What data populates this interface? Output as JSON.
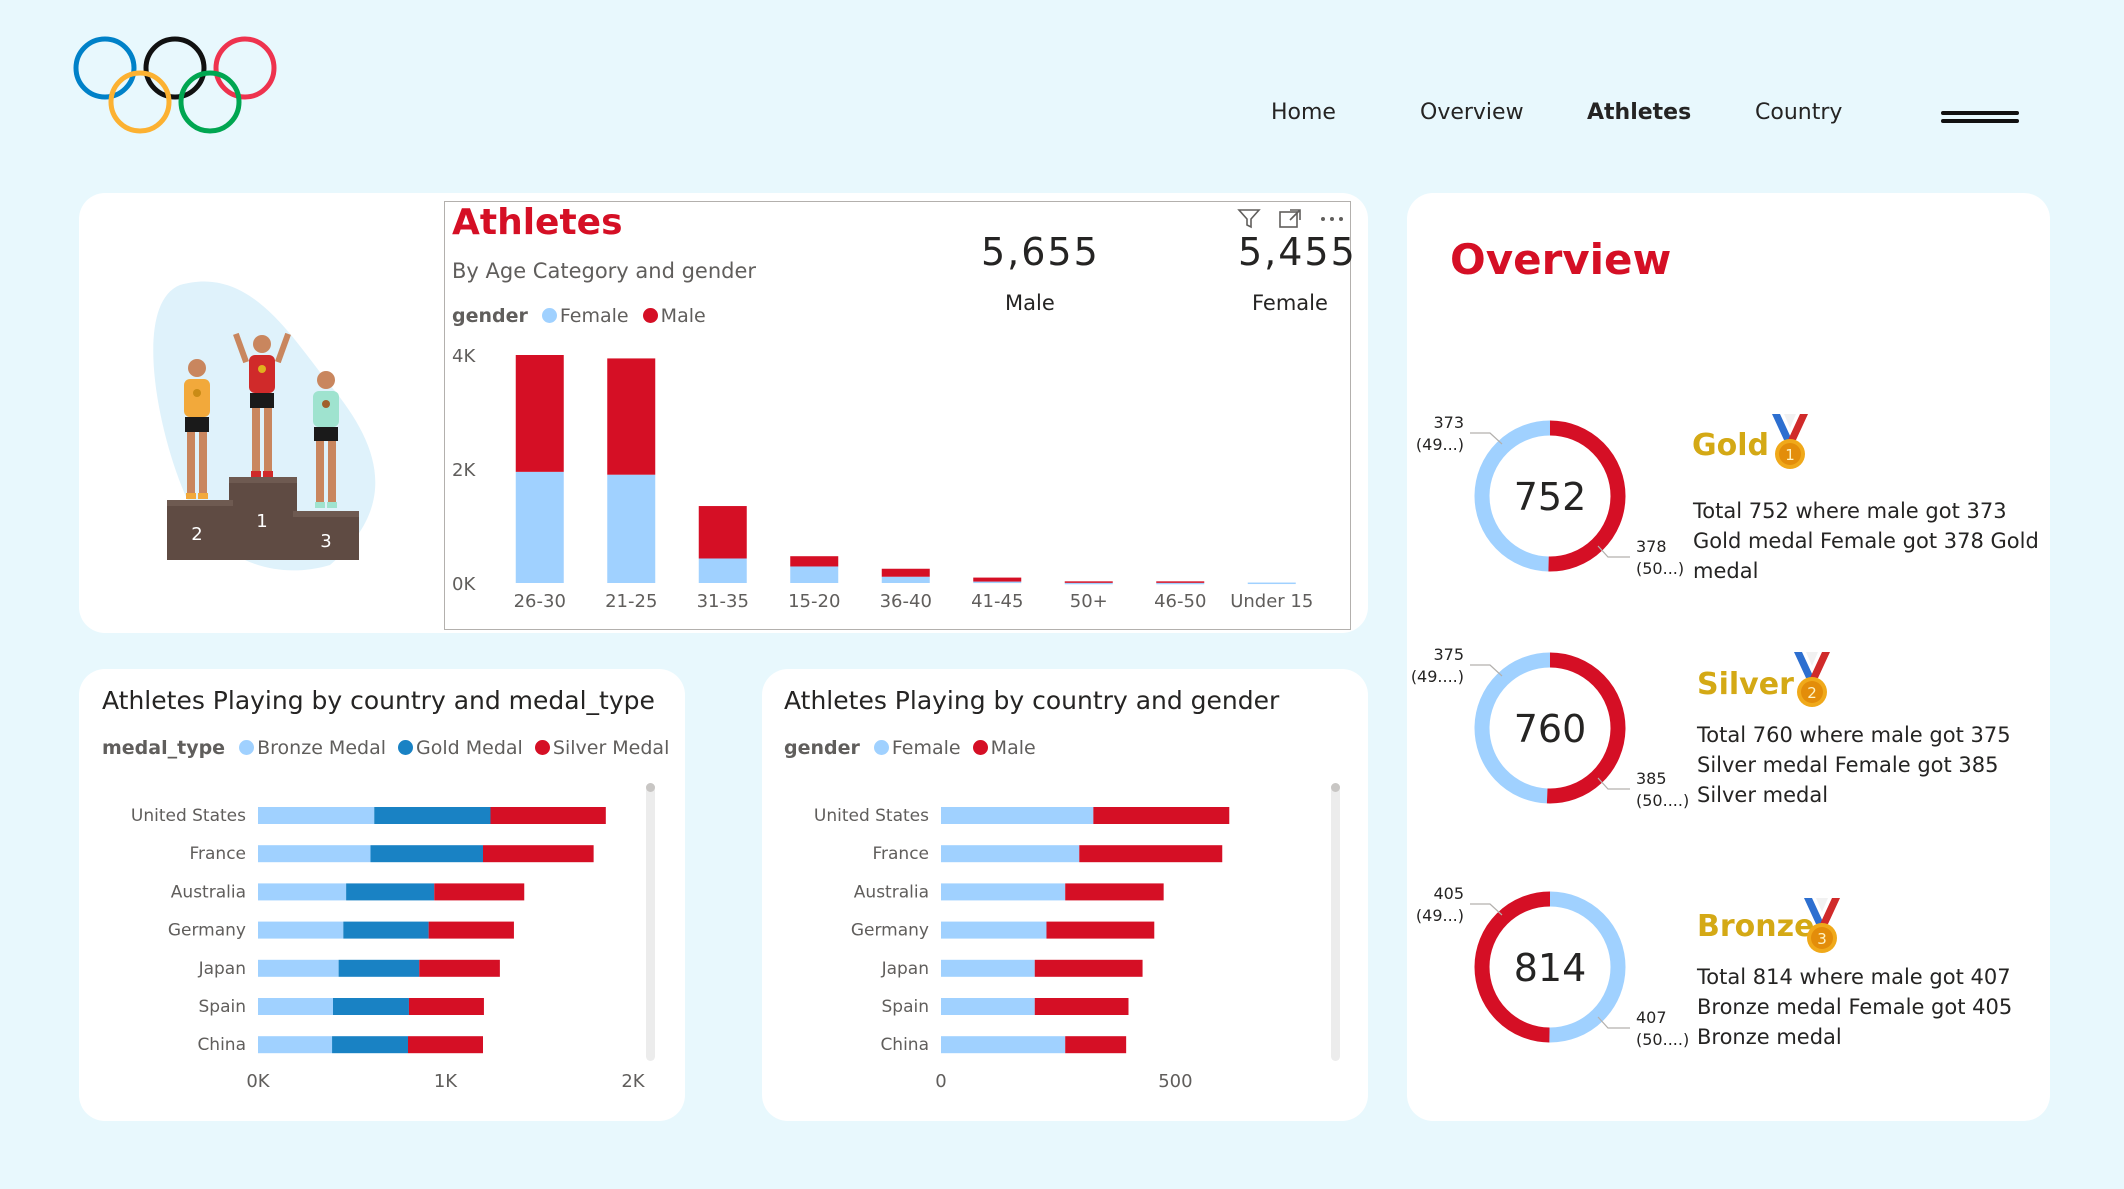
{
  "nav": {
    "items": [
      "Home",
      "Overview",
      "Athletes",
      "Country"
    ],
    "active": "Athletes"
  },
  "colors": {
    "female": "#a0d1ff",
    "male": "#d50f25",
    "gold_medal": "#1982c4",
    "bronze_medal": "#a0d1ff",
    "silver_medal": "#d50f25",
    "accent_red": "#d50f25",
    "medal_text": "#d4a915"
  },
  "athletes_card": {
    "title": "Athletes",
    "subtitle": "By Age Category and gender",
    "legend_title": "gender",
    "legend_items": [
      "Female",
      "Male"
    ],
    "kpis": [
      {
        "value": "5,655",
        "label": "Male"
      },
      {
        "value": "5,455",
        "label": "Female"
      }
    ],
    "header_icons": [
      "filter-icon",
      "focus-mode-icon",
      "more-options-icon"
    ],
    "podium_labels": [
      "2",
      "1",
      "3"
    ]
  },
  "chart_data": [
    {
      "type": "bar",
      "title": "Athletes",
      "subtitle": "By Age Category and gender",
      "stacked": true,
      "categories": [
        "26-30",
        "21-25",
        "31-35",
        "15-20",
        "36-40",
        "41-45",
        "50+",
        "46-50",
        "Under 15"
      ],
      "series": [
        {
          "name": "Female",
          "values": [
            1950,
            1900,
            430,
            290,
            110,
            25,
            4,
            4,
            8
          ]
        },
        {
          "name": "Male",
          "values": [
            2050,
            2040,
            920,
            180,
            140,
            70,
            25,
            25,
            0
          ]
        }
      ],
      "yticks": [
        "0K",
        "2K",
        "4K"
      ],
      "ylim": [
        0,
        4000
      ],
      "legend_title": "gender",
      "legend_position": "top-left"
    },
    {
      "type": "bar",
      "orientation": "horizontal",
      "stacked": true,
      "title": "Athletes Playing by country and medal_type",
      "categories": [
        "United States",
        "France",
        "Australia",
        "Germany",
        "Japan",
        "Spain",
        "China"
      ],
      "series": [
        {
          "name": "Bronze Medal",
          "values": [
            620,
            600,
            470,
            455,
            430,
            400,
            395
          ]
        },
        {
          "name": "Gold Medal",
          "values": [
            620,
            600,
            470,
            455,
            430,
            405,
            405
          ]
        },
        {
          "name": "Silver Medal",
          "values": [
            615,
            590,
            480,
            455,
            430,
            400,
            400
          ]
        }
      ],
      "xticks": [
        "0K",
        "1K",
        "2K"
      ],
      "xlim": [
        0,
        2000
      ],
      "legend_title": "medal_type",
      "legend_position": "top-left"
    },
    {
      "type": "bar",
      "orientation": "horizontal",
      "stacked": true,
      "title": "Athletes Playing by country and gender",
      "categories": [
        "United States",
        "France",
        "Australia",
        "Germany",
        "Japan",
        "Spain",
        "China"
      ],
      "series": [
        {
          "name": "Female",
          "values": [
            325,
            295,
            265,
            225,
            200,
            200,
            265
          ]
        },
        {
          "name": "Male",
          "values": [
            290,
            305,
            210,
            230,
            230,
            200,
            130
          ]
        }
      ],
      "xticks": [
        "0",
        "500"
      ],
      "xlim": [
        0,
        800
      ],
      "legend_title": "gender",
      "legend_position": "top-left"
    },
    {
      "type": "pie",
      "donut": true,
      "name": "Gold",
      "total_label": "752",
      "slices": [
        {
          "label": "373",
          "pct_label": "(49...)",
          "value": 373,
          "color": "#a0d1ff"
        },
        {
          "label": "378",
          "pct_label": "(50...)",
          "value": 378,
          "color": "#d50f25"
        }
      ]
    },
    {
      "type": "pie",
      "donut": true,
      "name": "Silver",
      "total_label": "760",
      "slices": [
        {
          "label": "375",
          "pct_label": "(49....)",
          "value": 375,
          "color": "#a0d1ff"
        },
        {
          "label": "385",
          "pct_label": "(50....)",
          "value": 385,
          "color": "#d50f25"
        }
      ]
    },
    {
      "type": "pie",
      "donut": true,
      "name": "Bronze",
      "total_label": "814",
      "slices": [
        {
          "label": "405",
          "pct_label": "(49...)",
          "value": 405,
          "color": "#d50f25"
        },
        {
          "label": "407",
          "pct_label": "(50....)",
          "value": 407,
          "color": "#a0d1ff"
        }
      ]
    }
  ],
  "overview": {
    "title": "Overview",
    "medals": [
      {
        "name": "Gold",
        "description": "Total 752 where male got 373 Gold medal Female got 378 Gold medal"
      },
      {
        "name": "Silver",
        "description": "Total 760 where male got 375 Silver medal Female got 385 Silver medal"
      },
      {
        "name": "Bronze",
        "description": "Total 814 where male got 407 Bronze medal Female got 405 Bronze medal"
      }
    ],
    "medal_numbers": [
      "1",
      "2",
      "3"
    ]
  },
  "country_medal_card": {
    "title": "Athletes Playing by country and medal_type",
    "legend_title": "medal_type",
    "legend_items": [
      "Bronze Medal",
      "Gold Medal",
      "Silver Medal"
    ]
  },
  "country_gender_card": {
    "title": "Athletes Playing by country and gender",
    "legend_title": "gender",
    "legend_items": [
      "Female",
      "Male"
    ]
  }
}
